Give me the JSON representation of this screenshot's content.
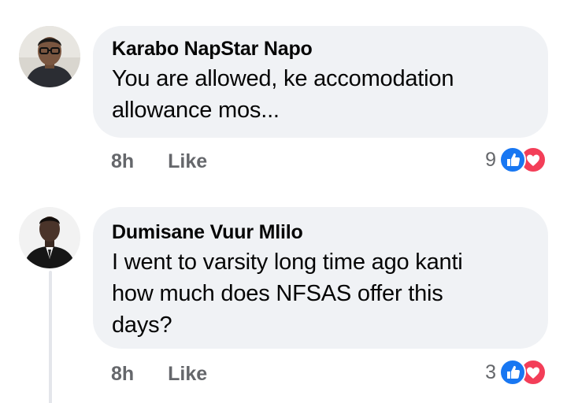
{
  "comments": [
    {
      "author": "Karabo NapStar Napo",
      "text_lines": [
        "You are allowed, ke accomodation",
        "allowance mos..."
      ],
      "time": "8h",
      "like_label": "Like",
      "reaction_count": "9",
      "reactions": [
        "like-icon",
        "love-icon"
      ]
    },
    {
      "author": "Dumisane Vuur Mlilo",
      "text_lines": [
        "I went to varsity long time ago kanti",
        "how much does NFSAS offer this",
        "days?"
      ],
      "time": "8h",
      "like_label": "Like",
      "reaction_count": "3",
      "reactions": [
        "like-icon",
        "love-icon"
      ]
    }
  ],
  "colors": {
    "bubble": "#f0f2f5",
    "meta_text": "#65676b",
    "like_blue": "#1877f2",
    "love_red": "#f33e58"
  }
}
